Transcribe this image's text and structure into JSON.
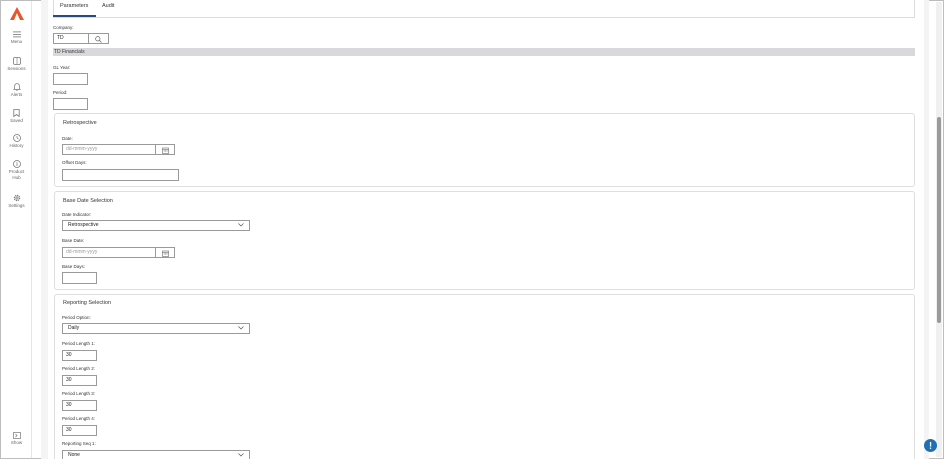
{
  "sidebar": {
    "items": [
      {
        "label": "Menu",
        "icon": "menu-icon"
      },
      {
        "label": "Sessions",
        "icon": "sessions-icon"
      },
      {
        "label": "Alerts",
        "icon": "bell-icon"
      },
      {
        "label": "Saved",
        "icon": "bookmark-icon"
      },
      {
        "label": "History",
        "icon": "clock-icon"
      },
      {
        "label": "Product",
        "label2": "Hub",
        "icon": "info-icon"
      },
      {
        "label": "Settings",
        "icon": "gear-icon"
      }
    ],
    "show_label": "Show",
    "logo_color": "#e8552a"
  },
  "tabs": [
    {
      "label": "Parameters",
      "active": true
    },
    {
      "label": "Audit",
      "active": false
    }
  ],
  "form": {
    "company_label": "Company:",
    "company_value": "TD",
    "company_name": "TD Financials",
    "gl_year_label": "GL Year:",
    "gl_year_value": "",
    "period_label": "Period:",
    "period_value": ""
  },
  "retrospective": {
    "title": "Retrospective",
    "date_label": "Date:",
    "date_placeholder": "dd-mmm-yyyy",
    "offset_label": "Offset Days:",
    "offset_value": ""
  },
  "base_date": {
    "title": "Base Date Selection",
    "indicator_label": "Date Indicator:",
    "indicator_value": "Retrospective",
    "date_label": "Base Date:",
    "date_placeholder": "dd-mmm-yyyy",
    "days_label": "Base Days:",
    "days_value": ""
  },
  "reporting": {
    "title": "Reporting Selection",
    "option_label": "Period Option:",
    "option_value": "Daily",
    "lengths": [
      {
        "label": "Period Length 1:",
        "value": "30"
      },
      {
        "label": "Period Length 2:",
        "value": "30"
      },
      {
        "label": "Period Length 3:",
        "value": "30"
      },
      {
        "label": "Period Length 4:",
        "value": "30"
      }
    ],
    "seq_label": "Reporting Seq 1:",
    "seq_value": "None"
  },
  "colors": {
    "accent": "#2c4a7a",
    "help": "#1f6fb5"
  }
}
